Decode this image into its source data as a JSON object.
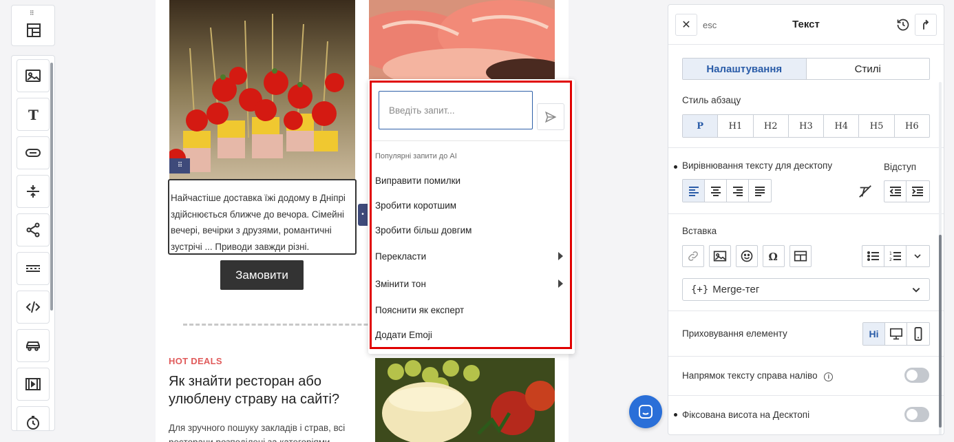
{
  "toolbar": {
    "tools": [
      "layout-icon",
      "image-icon",
      "text-icon",
      "button-icon",
      "spacer-icon",
      "share-icon",
      "divider-icon",
      "code-icon",
      "car-icon",
      "video-icon",
      "timer-icon"
    ]
  },
  "canvas": {
    "paragraph": "Найчастіше доставка їжі додому в Дніпрі здійснюється ближче до вечора. Сімейні вечері, вечірки з друзями, романтичні зустрічі ... Приводи завжди різні.",
    "order_button": "Замовити",
    "hot_deals": "HOT DEALS",
    "heading": "Як знайти ресторан або улюблену страву на сайті?",
    "body": "Для зручного пошуку закладів і страв, всі ресторани розподілені за категоріями"
  },
  "ai_menu": {
    "input_placeholder": "Введіть запит...",
    "popular_label": "Популярні запити до AI",
    "items": [
      {
        "label": "Виправити помилки",
        "submenu": false
      },
      {
        "label": "Зробити коротшим",
        "submenu": false
      },
      {
        "label": "Зробити більш довгим",
        "submenu": false
      },
      {
        "label": "Перекласти",
        "submenu": true
      },
      {
        "label": "Змінити тон",
        "submenu": true
      },
      {
        "label": "Пояснити як експерт",
        "submenu": false
      },
      {
        "label": "Додати Emoji",
        "submenu": false
      }
    ]
  },
  "panel": {
    "esc": "esc",
    "title": "Текст",
    "tabs": [
      "Налаштування",
      "Стилі"
    ],
    "active_tab": "Налаштування",
    "paragraph_style_label": "Стиль абзацу",
    "paragraph_styles": [
      "P",
      "H1",
      "H2",
      "H3",
      "H4",
      "H5",
      "H6"
    ],
    "selected_style": "P",
    "alignment_label": "Вирівнювання тексту для десктопу",
    "indent_label": "Відступ",
    "insert_label": "Вставка",
    "merge_tag": "Merge-тег",
    "hide_label": "Приховування елементу",
    "hide_options": [
      "Ні",
      "desktop-icon",
      "mobile-icon"
    ],
    "hide_selected": "Ні",
    "rtl_label": "Напрямок тексту справа наліво",
    "fixed_height_label": "Фіксована висота на Десктопі"
  },
  "colors": {
    "accent": "#2a5ca8",
    "highlight_frame": "#e00000",
    "chat_button": "#2a6fd8"
  }
}
